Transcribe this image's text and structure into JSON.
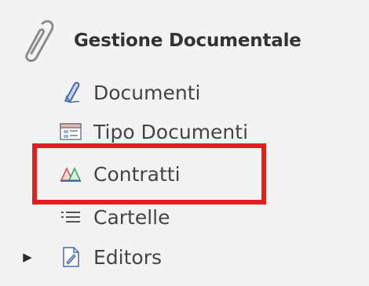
{
  "tree": {
    "root": {
      "label": "Gestione Documentale",
      "icon": "paperclip-icon"
    },
    "items": [
      {
        "label": "Documenti",
        "icon": "pen-document-icon",
        "expandable": false
      },
      {
        "label": "Tipo Documenti",
        "icon": "document-types-icon",
        "expandable": false
      },
      {
        "label": "Contratti",
        "icon": "contracts-icon",
        "expandable": false,
        "highlighted": true
      },
      {
        "label": "Cartelle",
        "icon": "list-icon",
        "expandable": false
      },
      {
        "label": "Editors",
        "icon": "edit-document-icon",
        "expandable": true
      }
    ]
  },
  "colors": {
    "highlight_border": "#e02020",
    "panel_background": "#f3f3f3",
    "text": "#444444"
  }
}
